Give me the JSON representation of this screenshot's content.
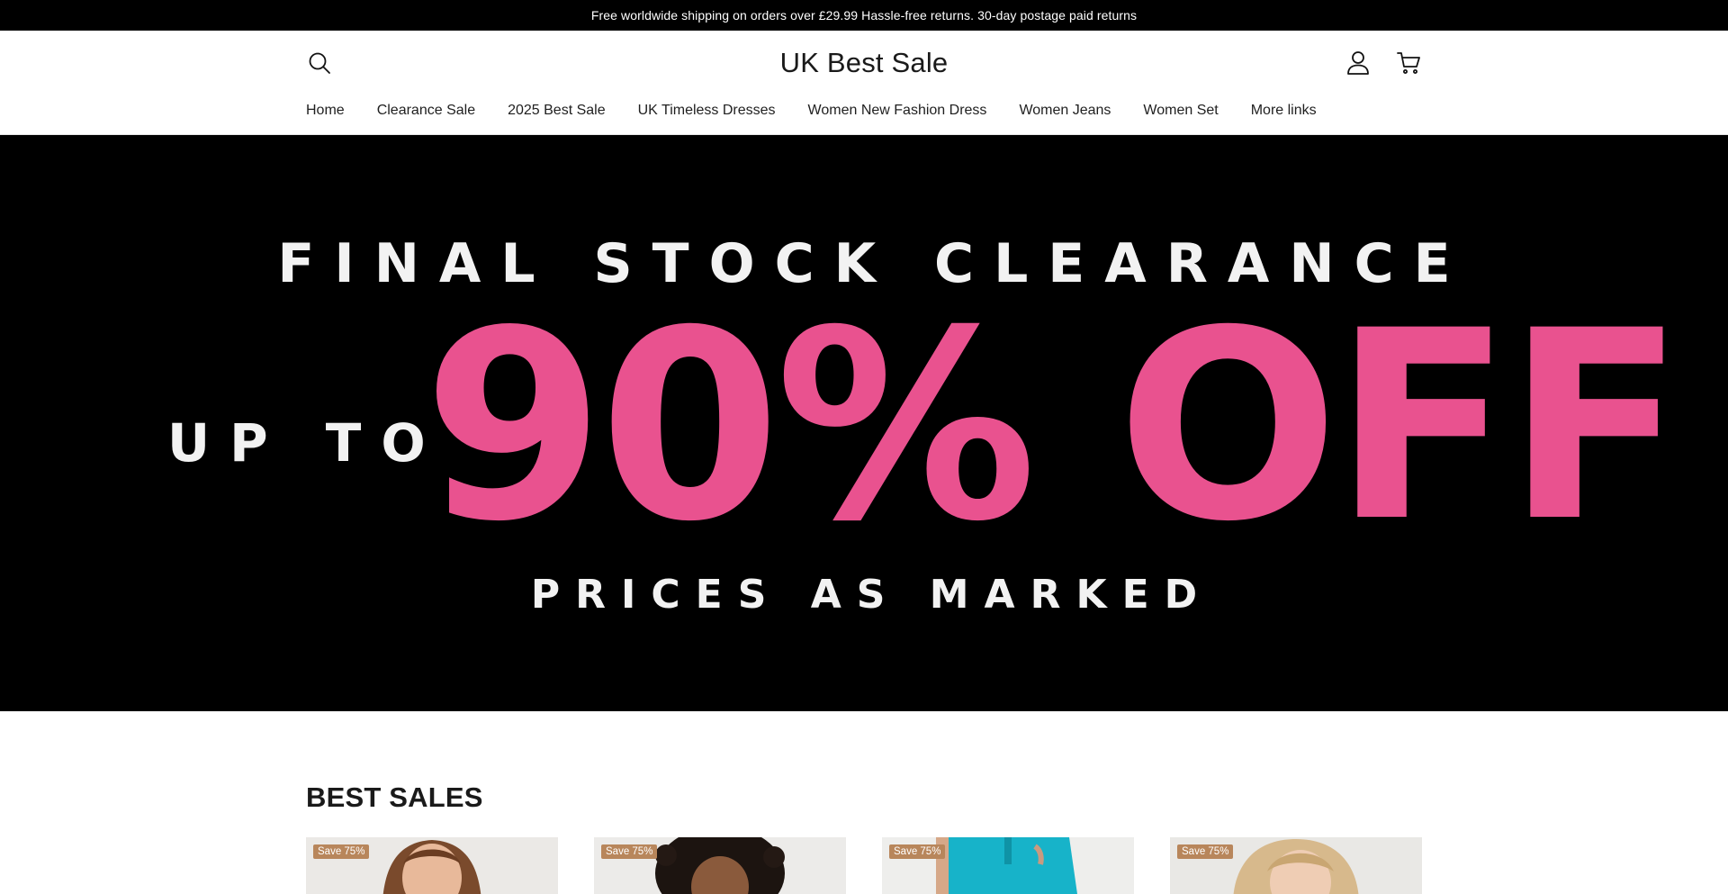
{
  "announcement": {
    "text": "Free worldwide shipping on orders over £29.99 Hassle-free returns. 30-day postage paid returns"
  },
  "header": {
    "brand": "UK Best Sale",
    "icons": [
      "search-icon",
      "account-icon",
      "cart-icon"
    ]
  },
  "nav": {
    "items": [
      {
        "label": "Home"
      },
      {
        "label": "Clearance Sale"
      },
      {
        "label": "2025 Best Sale"
      },
      {
        "label": "UK Timeless Dresses"
      },
      {
        "label": "Women New Fashion Dress"
      },
      {
        "label": "Women Jeans"
      },
      {
        "label": "Women Set"
      },
      {
        "label": "More links"
      }
    ]
  },
  "hero": {
    "line1": "FINAL STOCK CLEARANCE",
    "up_to": "UP TO",
    "big": "90% OFF",
    "line3": "PRICES AS MARKED",
    "accent_color": "#e9528f",
    "background": "#000000"
  },
  "best_sales": {
    "title": "BEST SALES",
    "products": [
      {
        "badge": "Save 75%"
      },
      {
        "badge": "Save 75%"
      },
      {
        "badge": "Save 75%"
      },
      {
        "badge": "Save 75%"
      }
    ],
    "badge_color": "#b8865b"
  }
}
